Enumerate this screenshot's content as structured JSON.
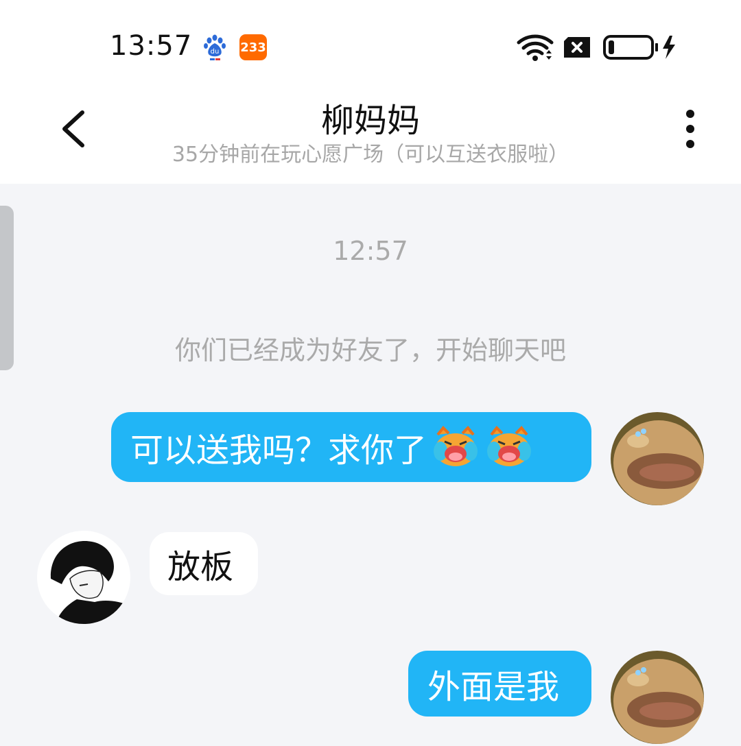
{
  "status_bar": {
    "time": "13:57",
    "app_badge_233": "233",
    "icons": [
      "baidu-icon",
      "app-233-icon",
      "wifi-icon",
      "sim-off-icon",
      "battery-charging-icon"
    ]
  },
  "header": {
    "title": "柳妈妈",
    "subtitle": "35分钟前在玩心愿广场（可以互送衣服啦）",
    "back_icon": "chevron-left-icon",
    "more_icon": "more-vertical-icon"
  },
  "chat": {
    "timestamp": "12:57",
    "system_note": "你们已经成为好友了，开始聊天吧",
    "messages": [
      {
        "from": "me",
        "text": "可以送我吗？求你了",
        "emojis": [
          "crying-face-emoji",
          "crying-face-emoji"
        ]
      },
      {
        "from": "them",
        "text": "放板"
      },
      {
        "from": "me",
        "text": "外面是我"
      }
    ]
  },
  "colors": {
    "outgoing_bubble": "#21b5f6",
    "incoming_bubble": "#ffffff",
    "chat_background": "#f4f5f8",
    "muted_text": "#aaaaaa"
  }
}
